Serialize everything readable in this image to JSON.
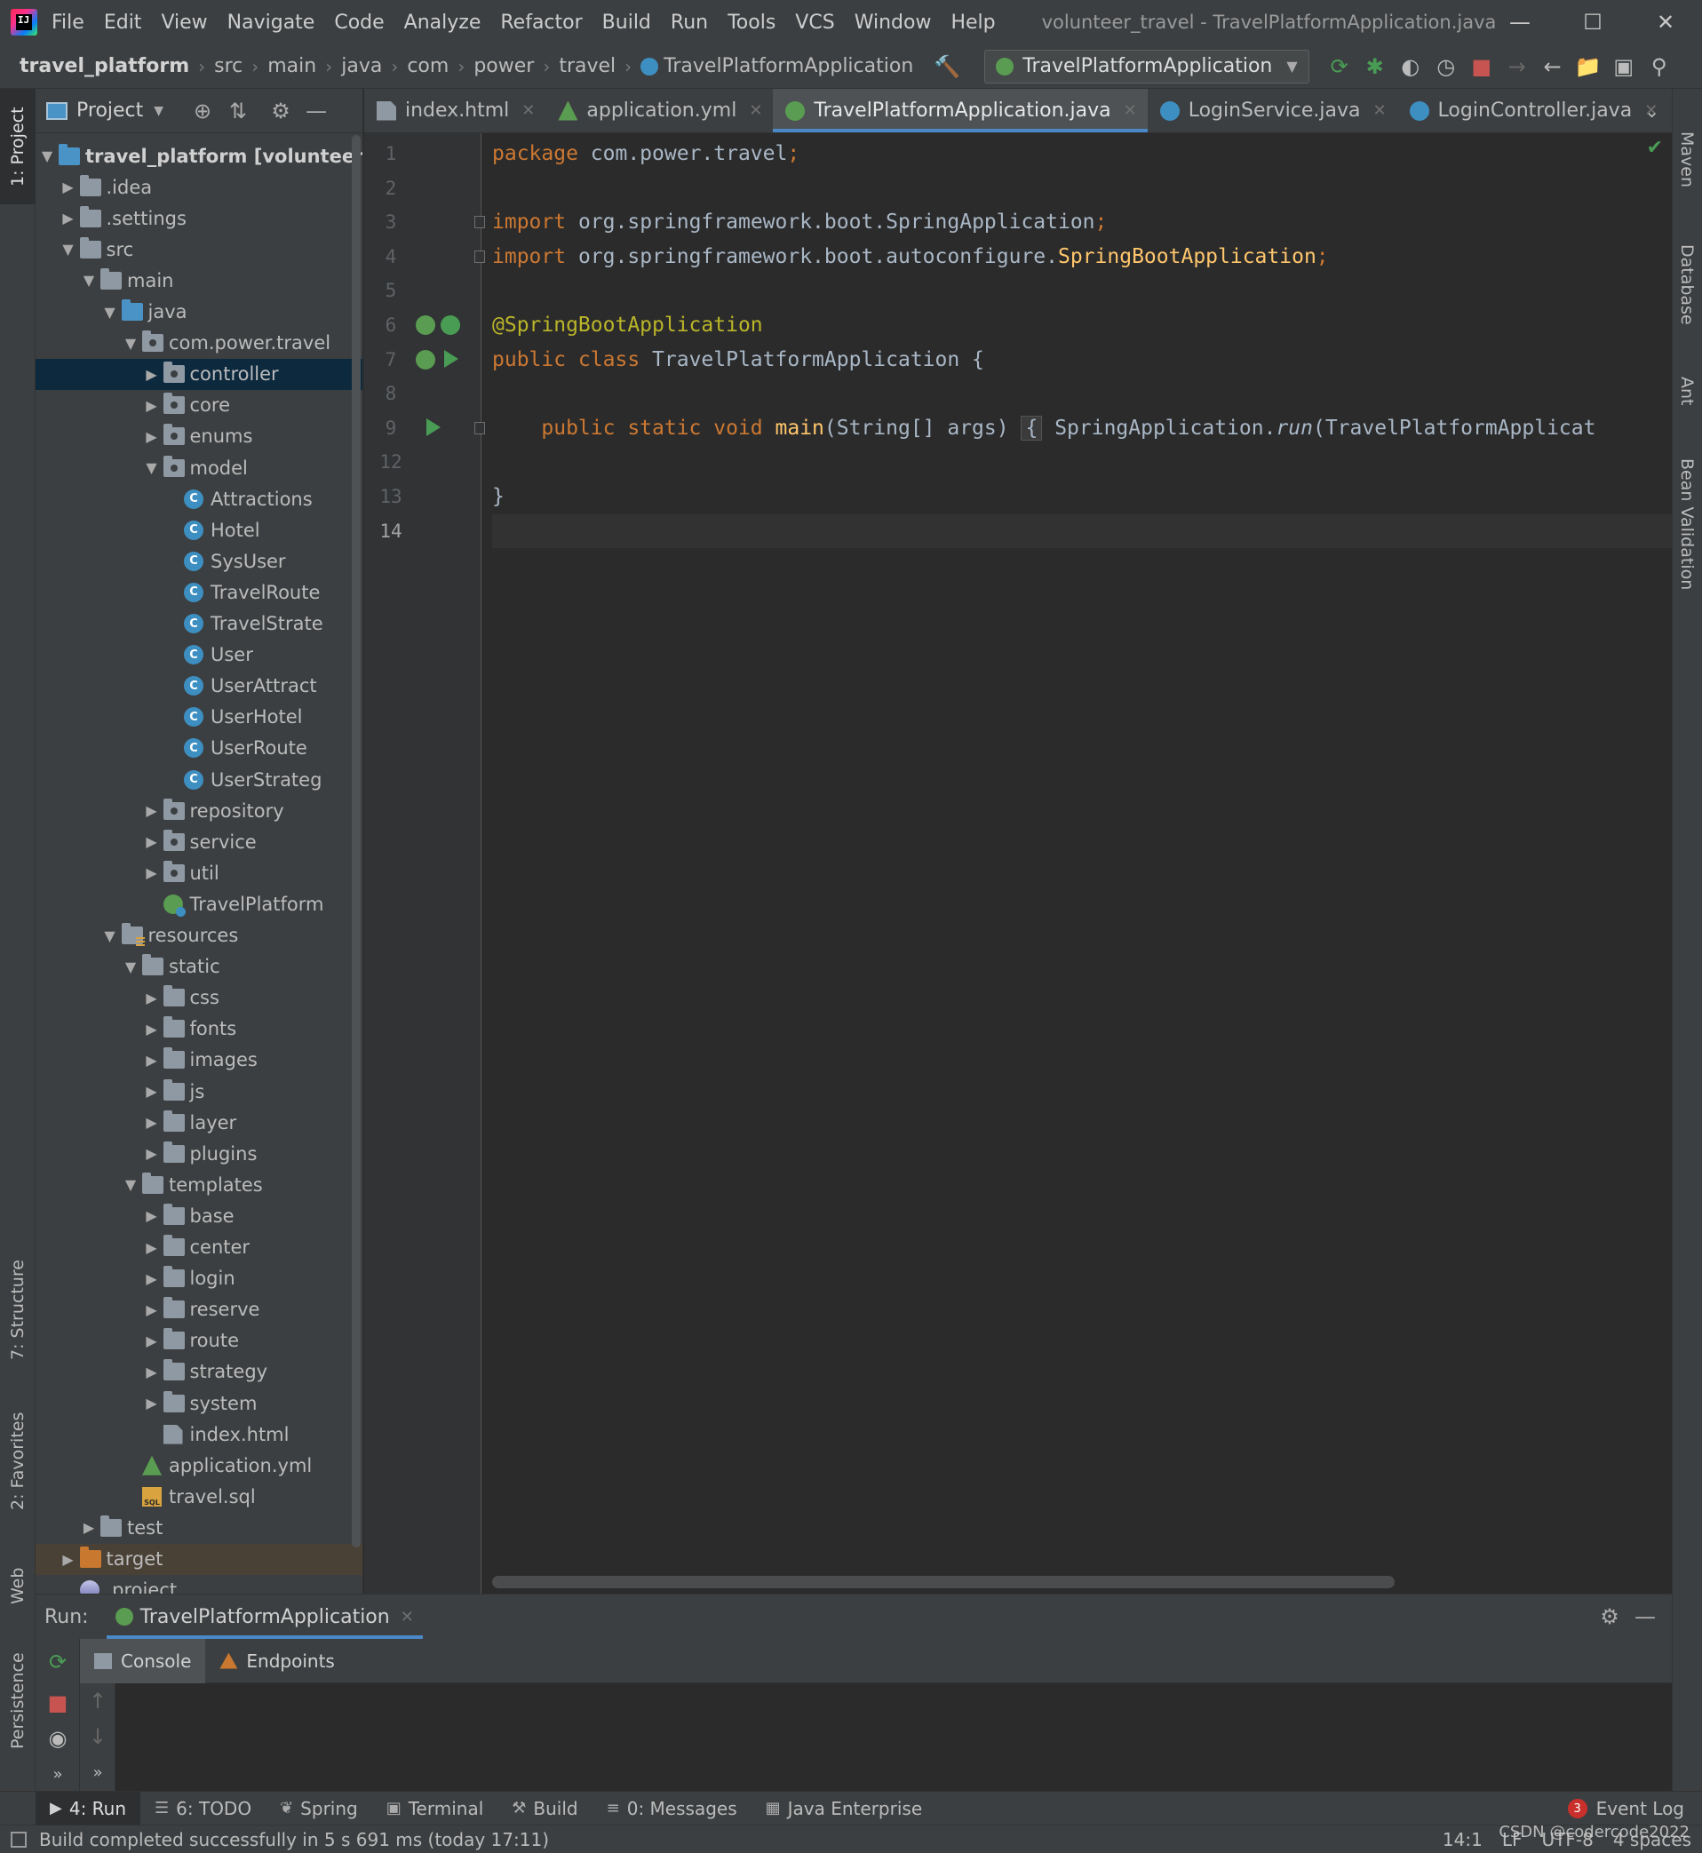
{
  "menubar": {
    "items": [
      "File",
      "Edit",
      "View",
      "Navigate",
      "Code",
      "Analyze",
      "Refactor",
      "Build",
      "Run",
      "Tools",
      "VCS",
      "Window",
      "Help"
    ],
    "window_title": "volunteer_travel - TravelPlatformApplication.java"
  },
  "navbar": {
    "breadcrumbs": [
      "travel_platform",
      "src",
      "main",
      "java",
      "com",
      "power",
      "travel",
      "TravelPlatformApplication"
    ],
    "run_config": "TravelPlatformApplication"
  },
  "left_stripe": {
    "project": "1: Project",
    "structure": "7: Structure",
    "favorites": "2: Favorites",
    "web": "Web",
    "persistence": "Persistence"
  },
  "right_stripe": {
    "maven": "Maven",
    "database": "Database",
    "ant": "Ant",
    "bean_validation": "Bean Validation"
  },
  "project_panel": {
    "title": "Project",
    "tree": [
      {
        "label": "travel_platform [volunteer_tra",
        "depth": 0,
        "expanded": true,
        "type": "module",
        "bold": true
      },
      {
        "label": ".idea",
        "depth": 1,
        "expanded": false,
        "type": "folder"
      },
      {
        "label": ".settings",
        "depth": 1,
        "expanded": false,
        "type": "folder"
      },
      {
        "label": "src",
        "depth": 1,
        "expanded": true,
        "type": "folder"
      },
      {
        "label": "main",
        "depth": 2,
        "expanded": true,
        "type": "folder"
      },
      {
        "label": "java",
        "depth": 3,
        "expanded": true,
        "type": "src"
      },
      {
        "label": "com.power.travel",
        "depth": 4,
        "expanded": true,
        "type": "pkg"
      },
      {
        "label": "controller",
        "depth": 5,
        "expanded": false,
        "type": "pkg",
        "selected": true
      },
      {
        "label": "core",
        "depth": 5,
        "expanded": false,
        "type": "pkg"
      },
      {
        "label": "enums",
        "depth": 5,
        "expanded": false,
        "type": "pkg"
      },
      {
        "label": "model",
        "depth": 5,
        "expanded": true,
        "type": "pkg"
      },
      {
        "label": "Attractions",
        "depth": 6,
        "type": "class"
      },
      {
        "label": "Hotel",
        "depth": 6,
        "type": "class"
      },
      {
        "label": "SysUser",
        "depth": 6,
        "type": "class"
      },
      {
        "label": "TravelRoute",
        "depth": 6,
        "type": "class"
      },
      {
        "label": "TravelStrate",
        "depth": 6,
        "type": "class"
      },
      {
        "label": "User",
        "depth": 6,
        "type": "class"
      },
      {
        "label": "UserAttract",
        "depth": 6,
        "type": "class"
      },
      {
        "label": "UserHotel",
        "depth": 6,
        "type": "class"
      },
      {
        "label": "UserRoute",
        "depth": 6,
        "type": "class"
      },
      {
        "label": "UserStrateg",
        "depth": 6,
        "type": "class"
      },
      {
        "label": "repository",
        "depth": 5,
        "expanded": false,
        "type": "pkg"
      },
      {
        "label": "service",
        "depth": 5,
        "expanded": false,
        "type": "pkg"
      },
      {
        "label": "util",
        "depth": 5,
        "expanded": false,
        "type": "pkg"
      },
      {
        "label": "TravelPlatform",
        "depth": 5,
        "type": "spring"
      },
      {
        "label": "resources",
        "depth": 3,
        "expanded": true,
        "type": "res"
      },
      {
        "label": "static",
        "depth": 4,
        "expanded": true,
        "type": "folder"
      },
      {
        "label": "css",
        "depth": 5,
        "expanded": false,
        "type": "folder"
      },
      {
        "label": "fonts",
        "depth": 5,
        "expanded": false,
        "type": "folder"
      },
      {
        "label": "images",
        "depth": 5,
        "expanded": false,
        "type": "folder"
      },
      {
        "label": "js",
        "depth": 5,
        "expanded": false,
        "type": "folder"
      },
      {
        "label": "layer",
        "depth": 5,
        "expanded": false,
        "type": "folder"
      },
      {
        "label": "plugins",
        "depth": 5,
        "expanded": false,
        "type": "folder"
      },
      {
        "label": "templates",
        "depth": 4,
        "expanded": true,
        "type": "folder"
      },
      {
        "label": "base",
        "depth": 5,
        "expanded": false,
        "type": "folder"
      },
      {
        "label": "center",
        "depth": 5,
        "expanded": false,
        "type": "folder"
      },
      {
        "label": "login",
        "depth": 5,
        "expanded": false,
        "type": "folder"
      },
      {
        "label": "reserve",
        "depth": 5,
        "expanded": false,
        "type": "folder"
      },
      {
        "label": "route",
        "depth": 5,
        "expanded": false,
        "type": "folder"
      },
      {
        "label": "strategy",
        "depth": 5,
        "expanded": false,
        "type": "folder"
      },
      {
        "label": "system",
        "depth": 5,
        "expanded": false,
        "type": "folder"
      },
      {
        "label": "index.html",
        "depth": 5,
        "type": "html"
      },
      {
        "label": "application.yml",
        "depth": 4,
        "type": "yml"
      },
      {
        "label": "travel.sql",
        "depth": 4,
        "type": "sql"
      },
      {
        "label": "test",
        "depth": 2,
        "expanded": false,
        "type": "folder"
      },
      {
        "label": "target",
        "depth": 1,
        "expanded": false,
        "type": "orange",
        "excluded": true
      },
      {
        "label": ".project",
        "depth": 1,
        "type": "project"
      }
    ]
  },
  "tabs": [
    {
      "label": "index.html",
      "icon": "html-file-icon",
      "active": false
    },
    {
      "label": "application.yml",
      "icon": "yml-file-icon",
      "active": false
    },
    {
      "label": "TravelPlatformApplication.java",
      "icon": "spring-class-icon",
      "active": true
    },
    {
      "label": "LoginService.java",
      "icon": "class-icon",
      "active": false
    },
    {
      "label": "LoginController.java",
      "icon": "class-icon",
      "active": false
    }
  ],
  "editor": {
    "line_numbers": [
      "1",
      "2",
      "3",
      "4",
      "5",
      "6",
      "7",
      "8",
      "9",
      "12",
      "13",
      "14"
    ],
    "current_line": "14",
    "lines": [
      [
        [
          "kw",
          "package"
        ],
        [
          "",
          "com.power.travel"
        ],
        [
          "kw",
          ";"
        ]
      ],
      [],
      [
        [
          "kw",
          "import"
        ],
        [
          "",
          "org.springframework.boot.SpringApplication"
        ],
        [
          "kw",
          ";"
        ]
      ],
      [
        [
          "kw",
          "import"
        ],
        [
          "",
          "org.springframework.boot.autoconfigure."
        ],
        [
          "fn",
          "SpringBootApplication"
        ],
        [
          "kw",
          ";"
        ]
      ],
      [],
      [
        [
          "ann",
          "@SpringBootApplication"
        ]
      ],
      [
        [
          "kw",
          "public class"
        ],
        [
          "",
          "TravelPlatformApplication {"
        ]
      ],
      [],
      [
        [
          "",
          "    "
        ],
        [
          "kw",
          "public static void"
        ],
        [
          "fn",
          "main"
        ],
        [
          "",
          "(String[] args)"
        ],
        [
          "folded",
          "{"
        ],
        [
          "",
          "SpringApplication."
        ],
        [
          "it",
          "run"
        ],
        [
          "",
          "(TravelPlatformApplicat"
        ]
      ],
      [],
      [
        [
          "",
          "}"
        ]
      ],
      []
    ]
  },
  "run_panel": {
    "label": "Run:",
    "tab": "TravelPlatformApplication",
    "console_tabs": [
      "Console",
      "Endpoints"
    ]
  },
  "bottom_tabs": [
    {
      "label": "4: Run",
      "icon": "run-icon",
      "active": true
    },
    {
      "label": "6: TODO",
      "icon": "todo-icon"
    },
    {
      "label": "Spring",
      "icon": "spring-icon"
    },
    {
      "label": "Terminal",
      "icon": "terminal-icon"
    },
    {
      "label": "Build",
      "icon": "build-icon"
    },
    {
      "label": "0: Messages",
      "icon": "messages-icon"
    },
    {
      "label": "Java Enterprise",
      "icon": "java-enterprise-icon"
    }
  ],
  "event_log": {
    "count": "3",
    "label": "Event Log"
  },
  "status": {
    "message": "Build completed successfully in 5 s 691 ms (today 17:11)",
    "position": "14:1",
    "line_sep": "LF",
    "encoding": "UTF-8",
    "indent": "4 spaces"
  },
  "watermark": "CSDN @codercode2022"
}
